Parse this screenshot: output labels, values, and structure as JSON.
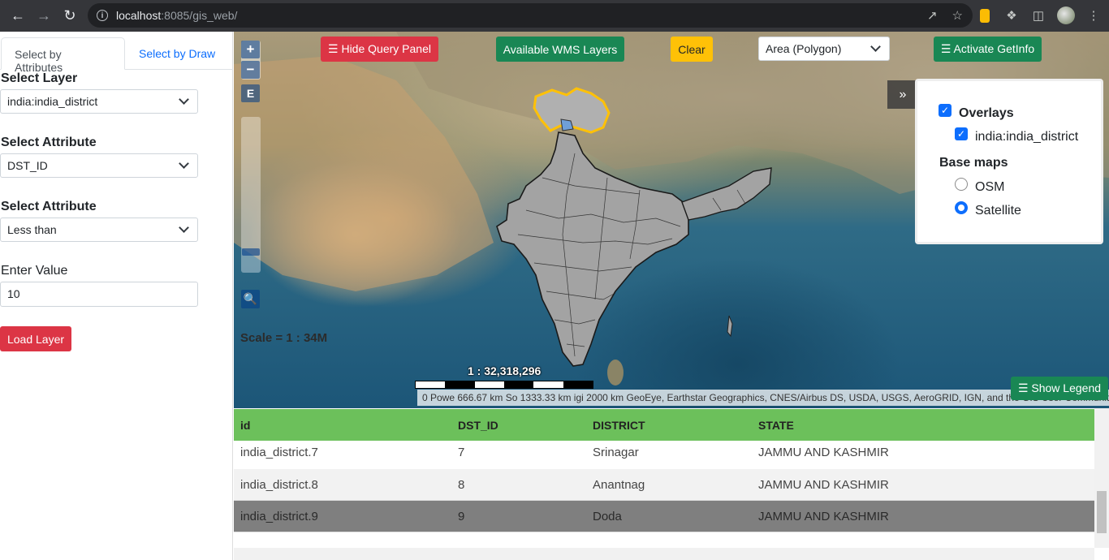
{
  "browser": {
    "url_host": "localhost",
    "url_path": ":8085/gis_web/"
  },
  "left_panel": {
    "tabs": [
      "Select by Attributes",
      "Select by Draw"
    ],
    "select_layer_label": "Select Layer",
    "select_layer_value": "india:india_district",
    "select_attribute_label": "Select Attribute",
    "select_attribute_value": "DST_ID",
    "select_operator_label": "Select Attribute",
    "select_operator_value": "Less than",
    "enter_value_label": "Enter Value",
    "enter_value": "10",
    "load_layer_button": "Load Layer"
  },
  "map": {
    "buttons": {
      "hide_query": "☰ Hide Query Panel",
      "wms_layers": "Available WMS Layers",
      "clear": "Clear",
      "get_info": "☰ Activate GetInfo",
      "show_legend": "☰ Show Legend"
    },
    "draw_type_value": "Area (Polygon)",
    "zoom_in": "+",
    "zoom_out": "−",
    "extent": "E",
    "scale_text": "Scale = 1 : 34M",
    "scale_ratio": "1 : 32,318,296",
    "attribution": "0  Powe 666.67 km So 1333.33 km igi 2000 km GeoEye, Earthstar Geographics, CNES/Airbus DS, USDA, USGS, AeroGRID, IGN, and the GIS User Community",
    "panel_toggle": "»",
    "layer_switcher": {
      "overlays_title": "Overlays",
      "overlay_item": "india:india_district",
      "base_maps_title": "Base maps",
      "base_options": [
        "OSM",
        "Satellite"
      ],
      "selected_base": "Satellite"
    }
  },
  "table": {
    "columns": [
      "id",
      "DST_ID",
      "DISTRICT",
      "STATE"
    ],
    "rows": [
      {
        "id": "india_district.7",
        "dst_id": "7",
        "district": "Srinagar",
        "state": "JAMMU AND KASHMIR"
      },
      {
        "id": "india_district.8",
        "dst_id": "8",
        "district": "Anantnag",
        "state": "JAMMU AND KASHMIR"
      },
      {
        "id": "india_district.9",
        "dst_id": "9",
        "district": "Doda",
        "state": "JAMMU AND KASHMIR"
      }
    ],
    "highlighted_row": 2
  },
  "colors": {
    "red": "#dc3545",
    "green": "#198754",
    "yellow": "#ffc107",
    "table_header": "#6cc05b",
    "highlight_row": "#7f7f7f"
  }
}
